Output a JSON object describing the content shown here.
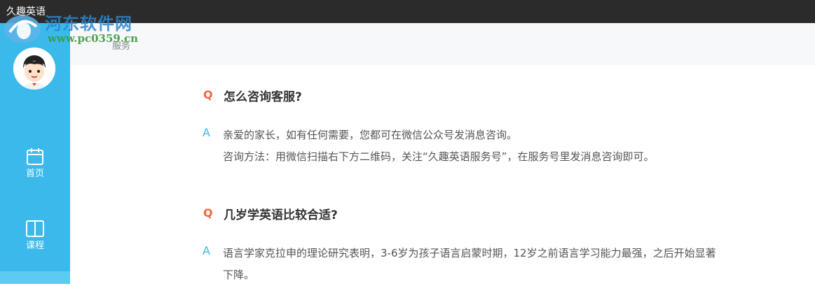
{
  "window": {
    "title": "久趣英语"
  },
  "watermark": {
    "main": "河东软件网",
    "url": "www.pc0359.cn"
  },
  "subheader": {
    "breadcrumb": "服务"
  },
  "sidebar": {
    "items": [
      {
        "label": "首页",
        "icon": "calendar-icon"
      },
      {
        "label": "课程",
        "icon": "book-icon"
      }
    ]
  },
  "faq": [
    {
      "q_mark": "Q",
      "question": "怎么咨询客服?",
      "a_mark": "A",
      "answer_lines": [
        "亲爱的家长，如有任何需要，您都可在微信公众号发消息咨询。",
        "咨询方法：用微信扫描右下方二维码，关注“久趣英语服务号”，在服务号里发消息咨询即可。"
      ]
    },
    {
      "q_mark": "Q",
      "question": "几岁学英语比较合适?",
      "a_mark": "A",
      "answer_lines": [
        "语言学家克拉申的理论研究表明，3-6岁为孩子语言启蒙时期，12岁之前语言学习能力最强，之后开始显著",
        "下降。"
      ]
    }
  ],
  "colors": {
    "sidebar": "#3ab9ea",
    "q_mark": "#f0663c",
    "a_mark": "#3ab9ea",
    "titlebar": "#2b2b2b"
  }
}
